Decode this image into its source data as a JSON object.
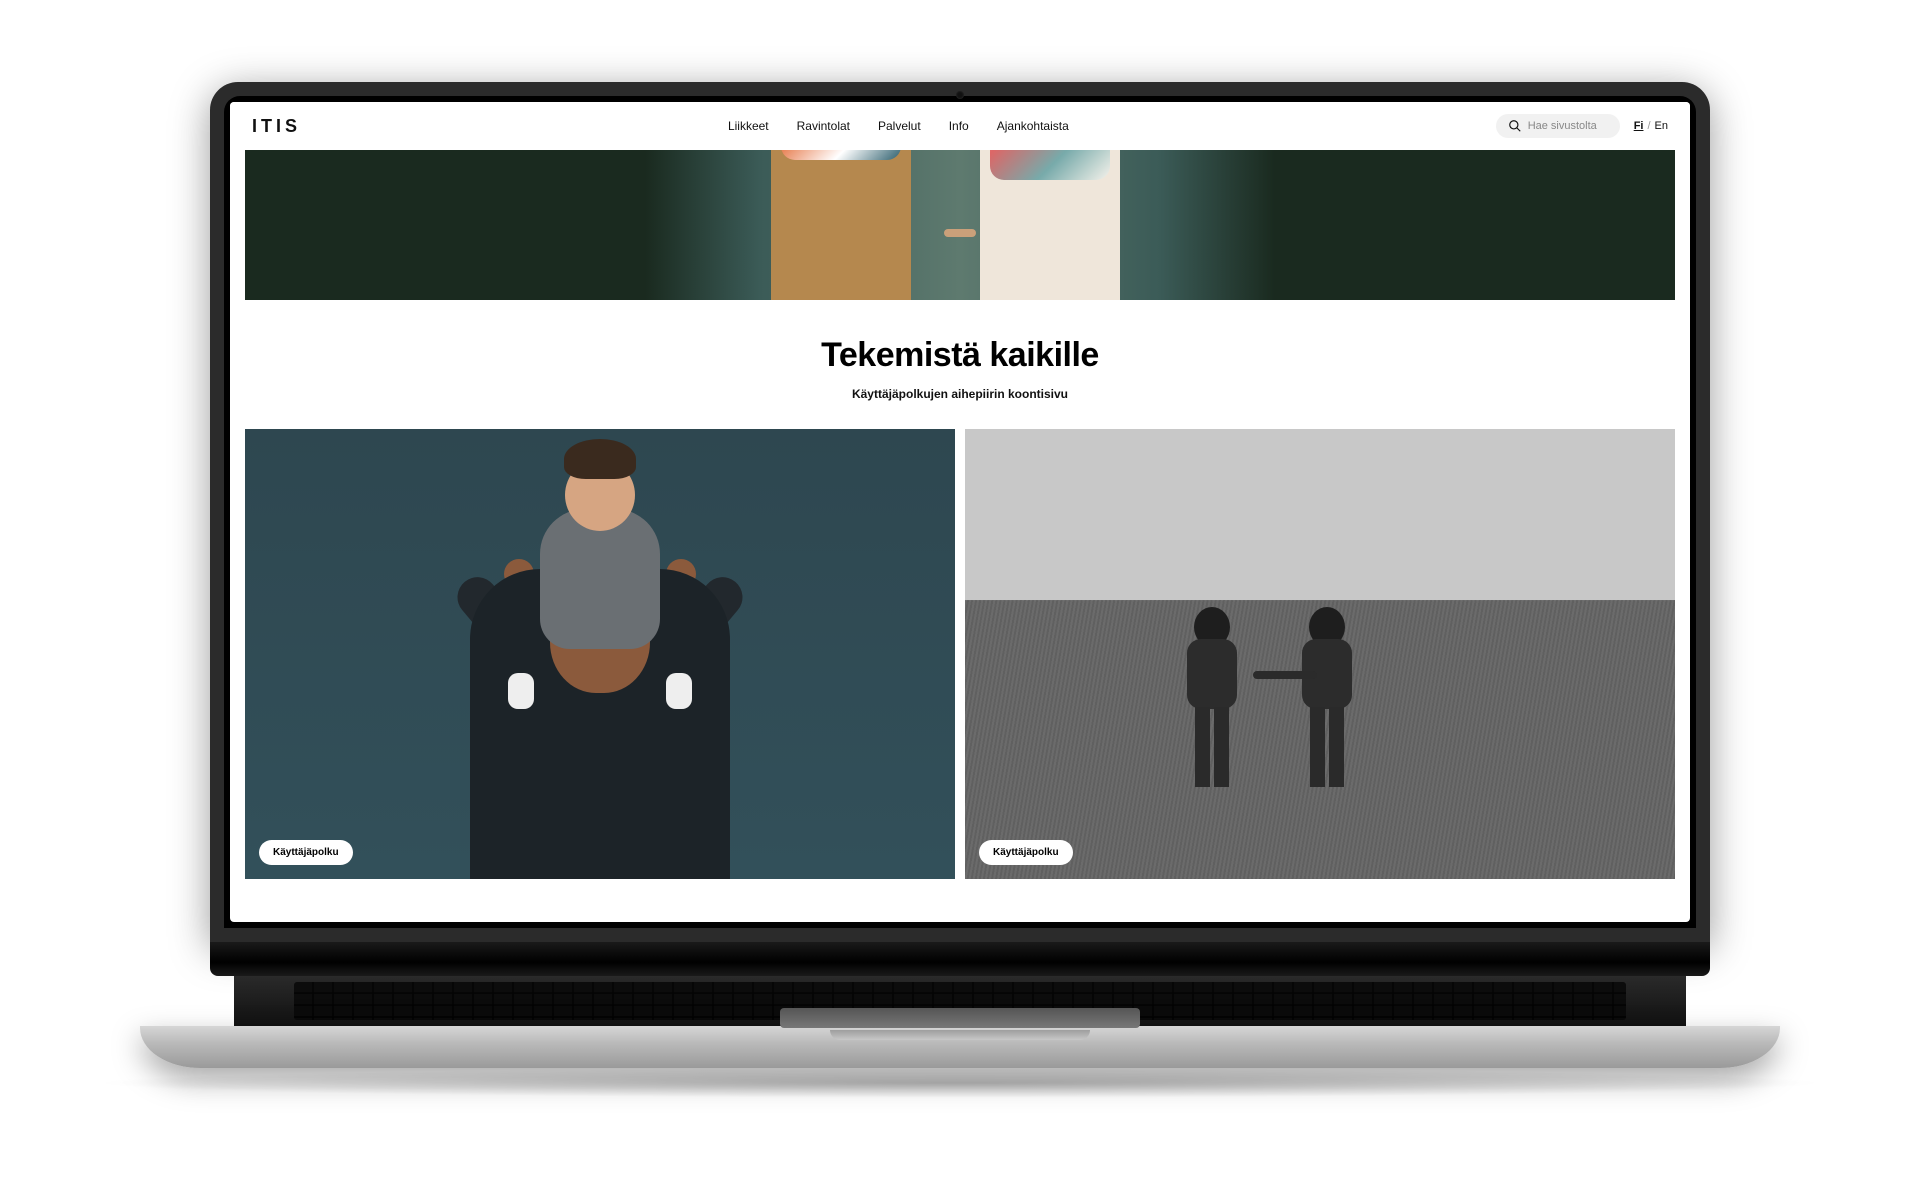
{
  "header": {
    "logo": "ITIS",
    "nav": [
      "Liikkeet",
      "Ravintolat",
      "Palvelut",
      "Info",
      "Ajankohtaista"
    ],
    "search_placeholder": "Hae sivustolta",
    "lang": {
      "fi": "Fi",
      "en": "En",
      "sep": "/"
    }
  },
  "hero_alt": "Kaksi lasta kävelee käsi kädessä",
  "title": {
    "heading": "Tekemistä kaikille",
    "subheading": "Käyttäjäpolkujen aihepiirin koontisivu"
  },
  "cards": [
    {
      "tag": "Käyttäjäpolku",
      "alt": "Isä kantaa hymyilevää lasta harteillaan"
    },
    {
      "tag": "Käyttäjäpolku",
      "alt": "Kaksi lasta kävelee pellolla (mustavalkoinen)"
    }
  ]
}
